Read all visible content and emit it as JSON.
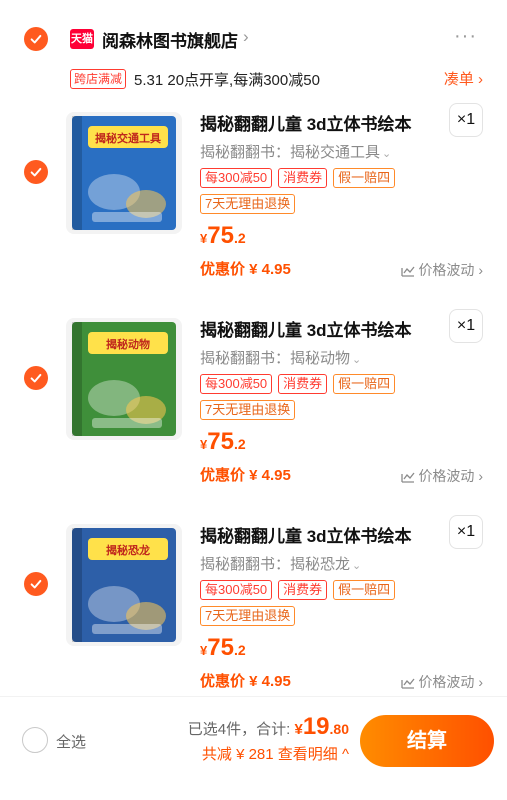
{
  "store": {
    "badge": "天猫",
    "name": "阅森林图书旗舰店",
    "chevron": "›",
    "more": "···"
  },
  "promo": {
    "tag": "跨店满减",
    "text": "5.31 20点开享,每满300减50",
    "link": "凑单 ›"
  },
  "items": [
    {
      "title": "揭秘翻翻儿童 3d立体书绘本",
      "qty": "×1",
      "spec": "揭秘翻翻书：揭秘交通工具",
      "tags": [
        "每300减50",
        "消费券",
        "假一赔四"
      ],
      "return_tag": "7天无理由退换",
      "price_symbol": "¥",
      "price_int": "75",
      "price_dec": ".2",
      "discount": "优惠价 ¥ 4.95",
      "trend": "价格波动 ›",
      "cover_title": "揭秘交通工具",
      "cover_color": "#2a6fc2"
    },
    {
      "title": "揭秘翻翻儿童 3d立体书绘本",
      "qty": "×1",
      "spec": "揭秘翻翻书：揭秘动物",
      "tags": [
        "每300减50",
        "消费券",
        "假一赔四"
      ],
      "return_tag": "7天无理由退换",
      "price_symbol": "¥",
      "price_int": "75",
      "price_dec": ".2",
      "discount": "优惠价 ¥ 4.95",
      "trend": "价格波动 ›",
      "cover_title": "揭秘动物",
      "cover_color": "#3f8f3a"
    },
    {
      "title": "揭秘翻翻儿童 3d立体书绘本",
      "qty": "×1",
      "spec": "揭秘翻翻书：揭秘恐龙",
      "tags": [
        "每300减50",
        "消费券",
        "假一赔四"
      ],
      "return_tag": "7天无理由退换",
      "price_symbol": "¥",
      "price_int": "75",
      "price_dec": ".2",
      "discount": "优惠价 ¥ 4.95",
      "trend": "价格波动 ›",
      "cover_title": "揭秘恐龙",
      "cover_color": "#2d5fa8"
    }
  ],
  "bottom": {
    "select_all": "全选",
    "selected": "已选4件，合计:",
    "total_symbol": "¥",
    "total_int": "19",
    "total_dec": ".80",
    "saved": "共减 ¥ 281  查看明细 ^",
    "checkout": "结算"
  },
  "colors": {
    "accent": "#ff5000",
    "check": "#ff5a1f",
    "tmall": "#ff0036"
  }
}
